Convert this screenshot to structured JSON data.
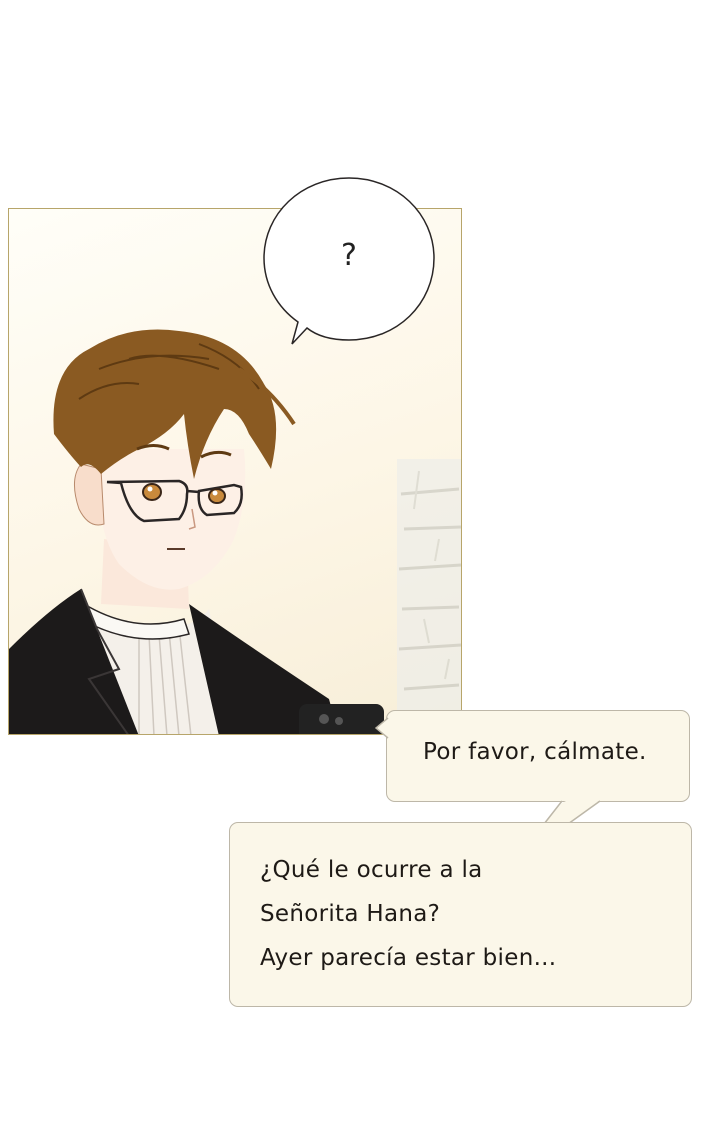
{
  "bubbles": {
    "thought": "?",
    "first": "Por favor, cálmate.",
    "second": [
      "¿Qué le ocurre a la",
      "Señorita Hana?",
      "Ayer parecía estar bien..."
    ]
  },
  "colors": {
    "panel_border": "#b7a56a",
    "box_fill": "#fbf7e9",
    "hair": "#8a5a22",
    "jacket": "#1c1a1a"
  }
}
